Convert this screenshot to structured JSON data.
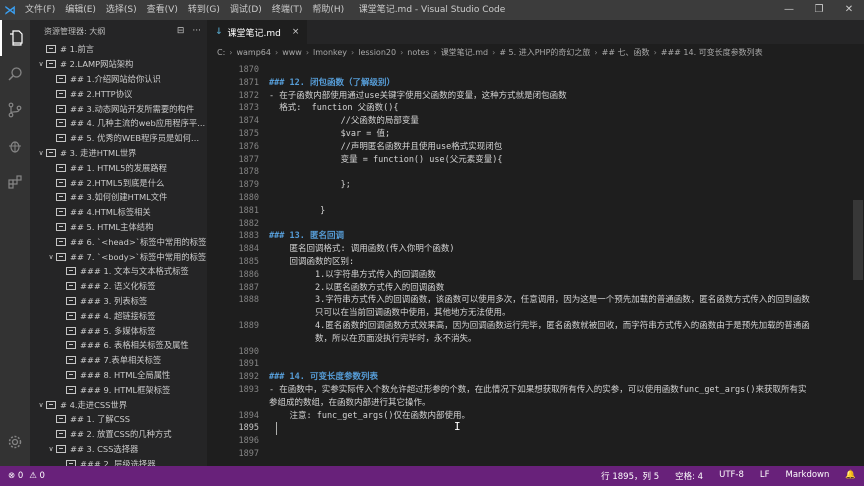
{
  "window": {
    "title": "课堂笔记.md - Visual Studio Code",
    "menu": [
      "文件(F)",
      "编辑(E)",
      "选择(S)",
      "查看(V)",
      "转到(G)",
      "调试(D)",
      "终端(T)",
      "帮助(H)"
    ],
    "controls": [
      "—",
      "❐",
      "✕"
    ]
  },
  "activity": {
    "icons": [
      "files-icon",
      "search-icon",
      "source-control-icon",
      "debug-icon",
      "extensions-icon"
    ]
  },
  "sidebar": {
    "title": "资源管理器: 大纲",
    "items": [
      {
        "text": "# 1.前言",
        "chev": ""
      },
      {
        "text": "# 2.LAMP网站架构",
        "chev": "∨"
      },
      {
        "text": "## 1.介绍网站给你认识",
        "chev": ""
      },
      {
        "text": "## 2.HTTP协议",
        "chev": ""
      },
      {
        "text": "## 3.动态网站开发所需要的构件",
        "chev": ""
      },
      {
        "text": "## 4. 几种主流的web应用程序平...",
        "chev": ""
      },
      {
        "text": "## 5. 优秀的WEB程序员是如何炼...",
        "chev": ""
      },
      {
        "text": "# 3. 走进HTML世界",
        "chev": "∨"
      },
      {
        "text": "## 1. HTML5的发展路程",
        "chev": ""
      },
      {
        "text": "## 2.HTML5到底是什么",
        "chev": ""
      },
      {
        "text": "## 3.如何创建HTML文件",
        "chev": ""
      },
      {
        "text": "## 4.HTML标签相关",
        "chev": ""
      },
      {
        "text": "## 5. HTML主体结构",
        "chev": ""
      },
      {
        "text": "## 6. `<head>`标签中常用的标签",
        "chev": ""
      },
      {
        "text": "## 7. `<body>`标签中常用的标签",
        "chev": "∨"
      },
      {
        "text": "### 1. 文本与文本格式标签",
        "chev": ""
      },
      {
        "text": "### 2. 语义化标签",
        "chev": ""
      },
      {
        "text": "### 3. 列表标签",
        "chev": ""
      },
      {
        "text": "### 4. 超链接标签",
        "chev": ""
      },
      {
        "text": "### 5. 多媒体标签",
        "chev": ""
      },
      {
        "text": "### 6. 表格相关标签及属性",
        "chev": ""
      },
      {
        "text": "### 7.表单相关标签",
        "chev": ""
      },
      {
        "text": "### 8. HTML全局属性",
        "chev": ""
      },
      {
        "text": "### 9. HTML框架标签",
        "chev": ""
      },
      {
        "text": "# 4.走进CSS世界",
        "chev": "∨"
      },
      {
        "text": "## 1. 了解CSS",
        "chev": ""
      },
      {
        "text": "## 2. 放置CSS的几种方式",
        "chev": ""
      },
      {
        "text": "## 3. CSS选择器",
        "chev": "∨"
      },
      {
        "text": "### 2. 层级选择器",
        "chev": ""
      }
    ]
  },
  "tab": {
    "label": "课堂笔记.md",
    "close": "×"
  },
  "breadcrumb": [
    "C:",
    "wamp64",
    "www",
    "lmonkey",
    "lession20",
    "notes",
    "课堂笔记.md",
    "# 5. 进入PHP的奇幻之旅",
    "## 七、函数",
    "### 14. 可变长度参数列表"
  ],
  "code_lines": [
    {
      "n": "1870",
      "t": ""
    },
    {
      "n": "1871",
      "t": "### 12. 闭包函数（了解级别）",
      "h": true
    },
    {
      "n": "1872",
      "t": "- 在子函数内部使用通过use关键字使用父函数的变量，这种方式就是闭包函数"
    },
    {
      "n": "1873",
      "t": "  格式:  function 父函数(){"
    },
    {
      "n": "1874",
      "t": "              //父函数的局部变量"
    },
    {
      "n": "1875",
      "t": "              $var = 值;"
    },
    {
      "n": "1876",
      "t": "              //声明匿名函数并且使用use格式实现闭包"
    },
    {
      "n": "1877",
      "t": "              变量 = function() use(父元素变量){"
    },
    {
      "n": "1878",
      "t": ""
    },
    {
      "n": "1879",
      "t": "              };"
    },
    {
      "n": "1880",
      "t": ""
    },
    {
      "n": "1881",
      "t": "          }"
    },
    {
      "n": "1882",
      "t": ""
    },
    {
      "n": "1883",
      "t": "### 13. 匿名回调",
      "h": true
    },
    {
      "n": "1884",
      "t": "    匿名回调格式: 调用函数(传入你明个函数)"
    },
    {
      "n": "1885",
      "t": "    回调函数的区别:"
    },
    {
      "n": "1886",
      "t": "         1.以字符串方式传入的回调函数"
    },
    {
      "n": "1887",
      "t": "         2.以匿名函数方式传入的回调函数"
    },
    {
      "n": "1888",
      "t": "         3.字符串方式传入的回调函数，该函数可以使用多次，任意调用，因为这是一个预先加载的普通函数，匿名函数方式传入的回到函数"
    },
    {
      "n": "",
      "t": "         只可以在当前回调函数中使用，其他地方无法使用。"
    },
    {
      "n": "1889",
      "t": "         4.匿名函数的回调函数方式效果高，因为回调函数运行完毕，匿名函数就被回收，而字符串方式传入的函数由于是预先加载的普通函"
    },
    {
      "n": "",
      "t": "         数，所以在页面没执行完毕时，永不消失。"
    },
    {
      "n": "1890",
      "t": ""
    },
    {
      "n": "1891",
      "t": ""
    },
    {
      "n": "1892",
      "t": "### 14. 可变长度参数列表",
      "h": true
    },
    {
      "n": "1893",
      "t": "- 在函数中，实参实际传入个数允许超过形参的个数，在此情况下如果想获取所有传入的实参，可以使用函数func_get_args()来获取所有实"
    },
    {
      "n": "",
      "t": "参组成的数组，在函数内部进行其它操作。"
    },
    {
      "n": "1894",
      "t": "    注意: func_get_args()仅在函数内部使用。"
    },
    {
      "n": "1895",
      "t": "",
      "cur": true
    },
    {
      "n": "1896",
      "t": ""
    },
    {
      "n": "1897",
      "t": ""
    }
  ],
  "status": {
    "errors": "⊗ 0",
    "warnings": "⚠ 0",
    "cursor": "行 1895，列 5",
    "spaces": "空格: 4",
    "encoding": "UTF-8",
    "eol": "LF",
    "language": "Markdown",
    "bell": "🔔"
  }
}
